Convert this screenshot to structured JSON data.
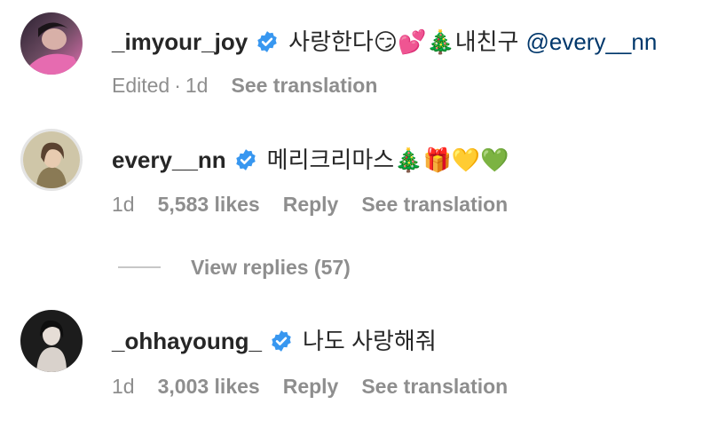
{
  "comments": [
    {
      "username": "_imyour_joy",
      "text": "사랑한다😏💕🎄내친구",
      "mention": "@every__nn",
      "edited": "Edited",
      "time": "1d",
      "see_translation": "See translation"
    },
    {
      "username": "every__nn",
      "text": "메리크리마스🎄🎁💛💚",
      "time": "1d",
      "likes": "5,583 likes",
      "reply": "Reply",
      "see_translation": "See translation"
    },
    {
      "username": "_ohhayoung_",
      "text": "나도 사랑해줘",
      "time": "1d",
      "likes": "3,003 likes",
      "reply": "Reply",
      "see_translation": "See translation"
    }
  ],
  "view_replies": "View replies (57)",
  "colors": {
    "verified": "#3897f0",
    "mention": "#00376b",
    "meta": "#8e8e8e",
    "text": "#262626"
  },
  "icons": {
    "verified": "verified-badge-icon"
  }
}
